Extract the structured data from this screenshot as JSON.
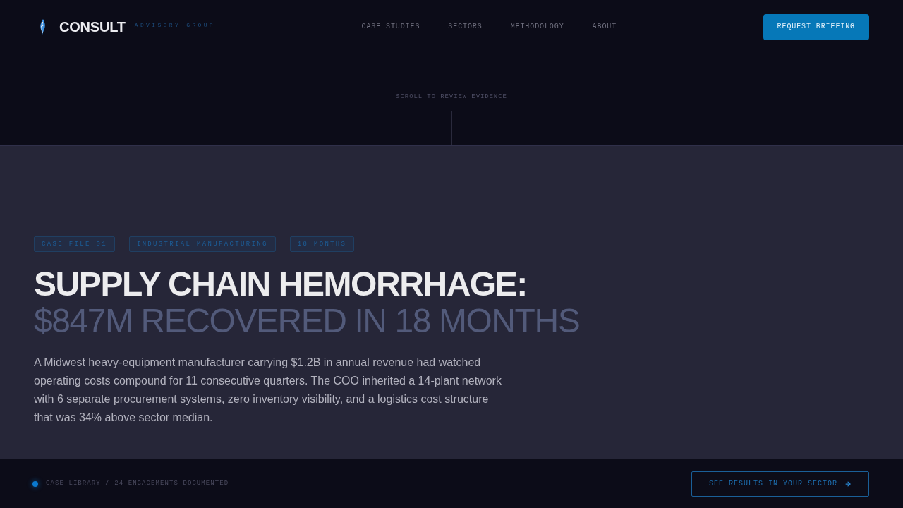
{
  "header": {
    "logo": {
      "name": "CONSULT",
      "tagline": "ADVISORY GROUP"
    },
    "nav": [
      "CASE STUDIES",
      "SECTORS",
      "METHODOLOGY",
      "ABOUT"
    ],
    "cta": "REQUEST BRIEFING"
  },
  "scroll_prompt": "SCROLL TO REVIEW EVIDENCE",
  "case": {
    "tags": [
      "CASE FILE 01",
      "INDUSTRIAL MANUFACTURING",
      "18 MONTHS"
    ],
    "title": "SUPPLY CHAIN HEMORRHAGE:",
    "subtitle": "$847M RECOVERED IN 18 MONTHS",
    "summary": "A Midwest heavy-equipment manufacturer carrying $1.2B in annual revenue had watched operating costs compound for 11 consecutive quarters. The COO inherited a 14-plant network with 6 separate procurement systems, zero inventory visibility, and a logistics cost structure that was 34% above sector median."
  },
  "footer": {
    "status": "CASE LIBRARY / 24 ENGAGEMENTS DOCUMENTED",
    "cta": "SEE RESULTS IN YOUR SECTOR"
  }
}
